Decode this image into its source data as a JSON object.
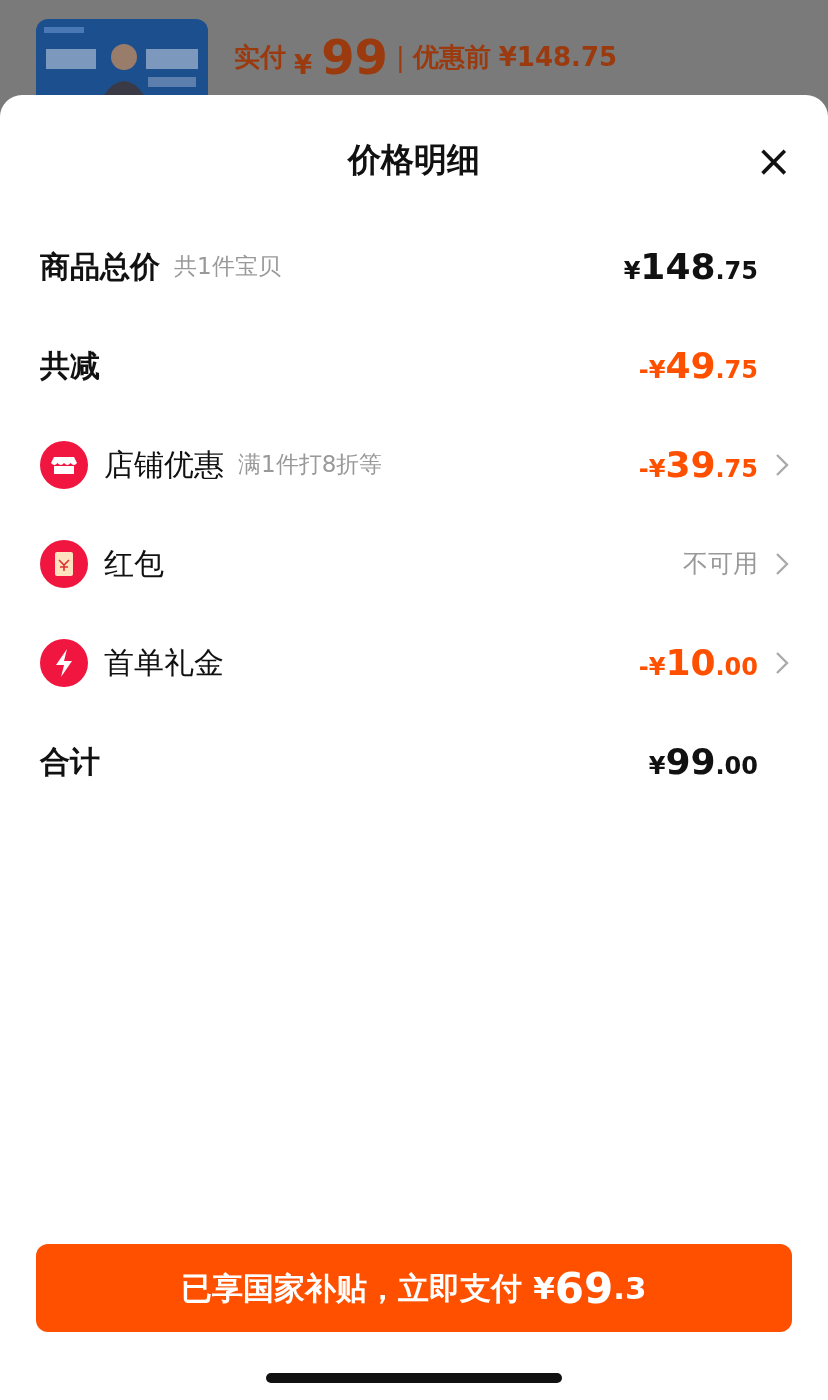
{
  "background_page": {
    "kind": "picture",
    "price_label": "实付",
    "price_symbol": "¥",
    "price": "99",
    "separator": "|",
    "original_label": "优惠前",
    "original_price": "¥148.75"
  },
  "sheet": {
    "title": "价格明细",
    "close": "×"
  },
  "rows": [
    {
      "kind": "plain",
      "label": "商品总价",
      "note": "共1件宝贝",
      "sign": "",
      "symbol": "¥",
      "whole": "148",
      "fraction": ".75",
      "discount": false
    },
    {
      "kind": "plain",
      "label": "共减",
      "sign": "-",
      "symbol": "¥",
      "whole": "49",
      "fraction": ".75",
      "discount": true
    },
    {
      "kind": "shop",
      "label": "店铺优惠",
      "note": "满1件打8折等",
      "sign": "-",
      "symbol": "¥",
      "whole": "39",
      "fraction": ".75",
      "discount": true,
      "chevron": true
    },
    {
      "kind": "redpacket",
      "label": "红包",
      "status": "不可用",
      "chevron": true
    },
    {
      "kind": "flash",
      "label": "首单礼金",
      "sign": "-",
      "symbol": "¥",
      "whole": "10",
      "fraction": ".00",
      "discount": true,
      "chevron": true
    },
    {
      "kind": "plain",
      "label": "合计",
      "sign": "",
      "symbol": "¥",
      "whole": "99",
      "fraction": ".00",
      "discount": false
    }
  ],
  "pay_button": {
    "label": "已享国家补贴，立即支付",
    "symbol": "¥",
    "whole": "69",
    "fraction": ".3"
  }
}
